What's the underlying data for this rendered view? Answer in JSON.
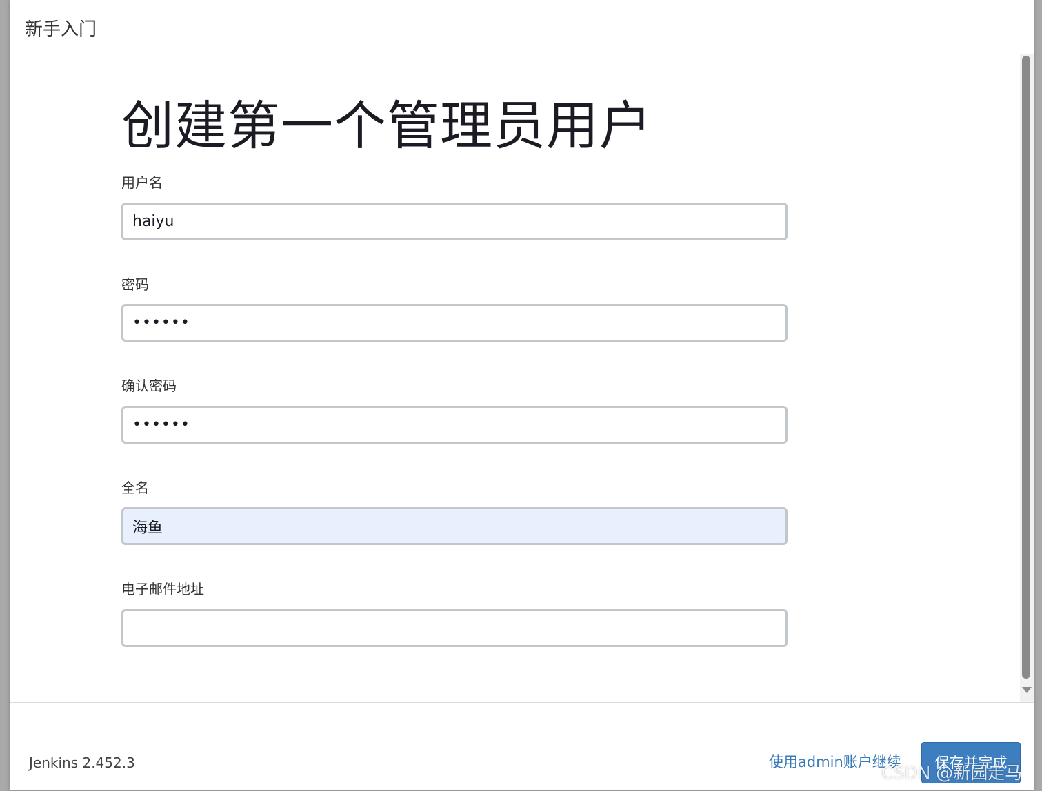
{
  "header": {
    "title": "新手入门"
  },
  "main": {
    "title": "创建第一个管理员用户",
    "fields": {
      "username": {
        "label": "用户名",
        "value": "haiyu"
      },
      "password": {
        "label": "密码",
        "value": "••••••"
      },
      "confirm_password": {
        "label": "确认密码",
        "value": "••••••"
      },
      "fullname": {
        "label": "全名",
        "value": "海鱼"
      },
      "email": {
        "label": "电子邮件地址",
        "value": ""
      }
    }
  },
  "footer": {
    "version": "Jenkins 2.452.3",
    "continue_link": "使用admin账户继续",
    "save_button": "保存并完成"
  },
  "watermark": "CSDN @新园走马",
  "colors": {
    "link": "#3a7ab8",
    "button": "#3d7ec1",
    "input_border": "#c2c7cc",
    "autofill_bg": "#e8f0fe"
  }
}
